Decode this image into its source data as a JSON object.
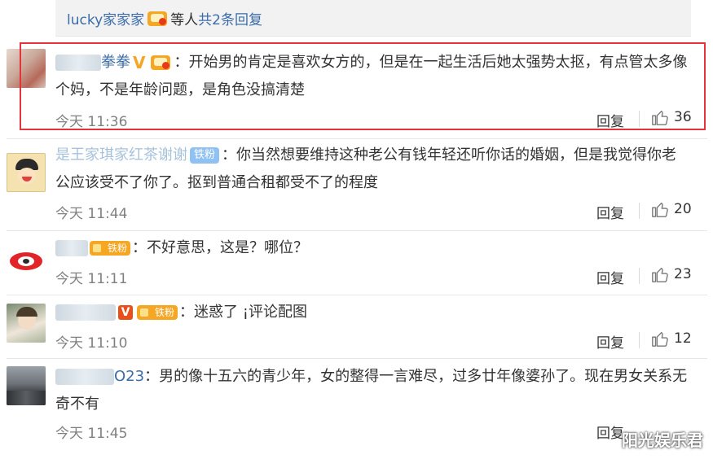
{
  "top_reply": {
    "user": "lucky家家家",
    "text": "等人",
    "count_link": "共2条回复"
  },
  "comments": [
    {
      "name_suffix": "拳拳",
      "text_line1": "：开始男的肯定是喜欢女方的，但是在一起生活后她太强势太抠，有点管太多像",
      "text_line2": "个妈，不是年龄问题，是角色没搞清楚",
      "time": "今天 11:36",
      "reply": "回复",
      "likes": "36"
    },
    {
      "name_suffix": "是王家琪家红茶谢谢",
      "badge": "铁粉",
      "text_line1": "：你当然想要维持这种老公有钱年轻还听你话的婚姻，但是我觉得你老",
      "text_line2": "公应该受不了你了。抠到普通合租都受不了的程度",
      "time": "今天 11:44",
      "reply": "回复",
      "likes": "20"
    },
    {
      "badge": "铁粉",
      "text_line1": "：不好意思，这是？哪位？",
      "time": "今天 11:11",
      "reply": "回复",
      "likes": "23"
    },
    {
      "badge": "铁粉",
      "text_line1": "：迷惑了 ¡评论配图",
      "time": "今天 11:10",
      "reply": "回复",
      "likes": "12"
    },
    {
      "name_suffix": "O23",
      "text_line1": "：男的像十五六的青少年，女的整得一言难尽，过多廿年像婆孙了。现在男女关系无",
      "text_line2": "奇不有",
      "time": "今天 11:45",
      "reply": "回复"
    }
  ],
  "watermark": "阳光娱乐君",
  "colors": {
    "link": "#3b6ca8",
    "highlight_border": "#e5333b",
    "badge_orange": "#f5a623",
    "badge_blue": "#8fc1f2",
    "time_gray": "#808080"
  }
}
